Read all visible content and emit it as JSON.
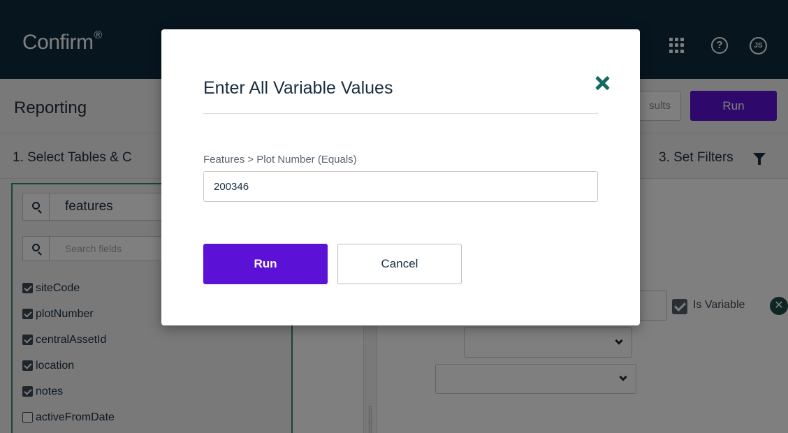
{
  "app": {
    "brand": "Confirm",
    "brand_mark": "®",
    "avatar_initials": "JS",
    "help_glyph": "?"
  },
  "header": {
    "title": "Reporting",
    "results_label": "sults",
    "run_label": "Run"
  },
  "sections": {
    "select_tables": "1. Select Tables & C",
    "set_filters": "3. Set Filters"
  },
  "left_panel": {
    "table_search_value": "features",
    "field_search_placeholder": "Search fields",
    "fields": [
      {
        "label": "siteCode",
        "checked": true
      },
      {
        "label": "plotNumber",
        "checked": true
      },
      {
        "label": "centralAssetId",
        "checked": true
      },
      {
        "label": "location",
        "checked": true
      },
      {
        "label": "notes",
        "checked": true
      },
      {
        "label": "activeFromDate",
        "checked": false
      }
    ]
  },
  "filters": {
    "is_variable_label": "Is Variable",
    "is_variable_checked": true,
    "remove_glyph": "✕"
  },
  "modal": {
    "title": "Enter All Variable Values",
    "variable_label": "Features > Plot Number (Equals)",
    "variable_value": "200346",
    "run_label": "Run",
    "cancel_label": "Cancel"
  },
  "colors": {
    "topbar": "#0f2a3f",
    "accent_purple": "#5c12d6",
    "accent_teal": "#136a5e"
  },
  "icons": [
    "apps-grid-icon",
    "help-icon",
    "search-icon",
    "filter-icon",
    "close-icon",
    "chevron-down-icon",
    "remove-icon",
    "drag-grip-icon"
  ]
}
